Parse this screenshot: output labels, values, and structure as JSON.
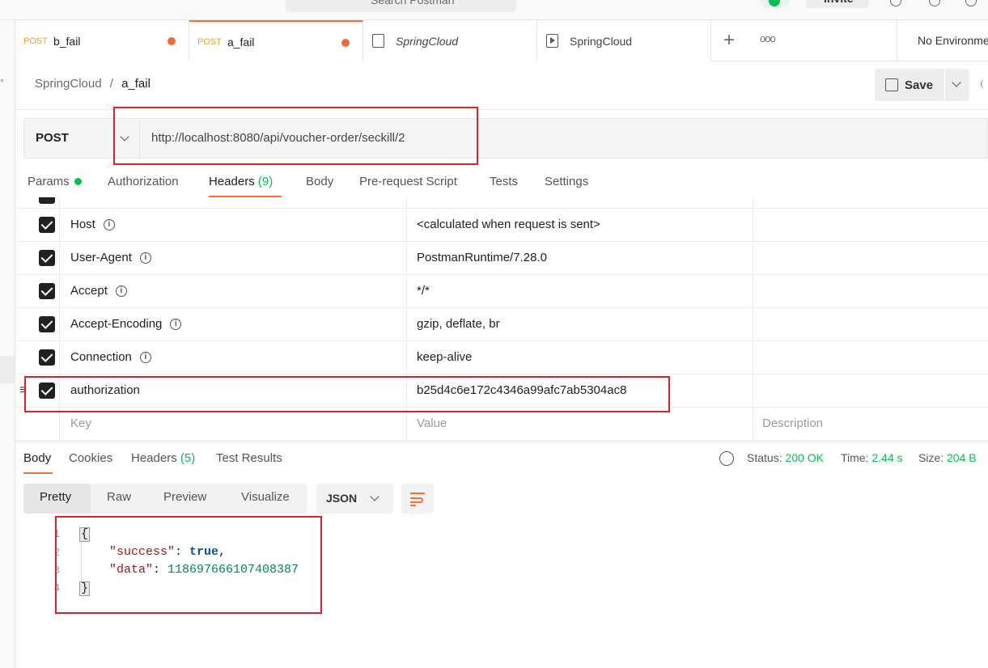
{
  "topbar": {
    "search_placeholder": "Search Postman",
    "invite_label": "Invite"
  },
  "tabs": [
    {
      "method": "POST",
      "name": "b_fail",
      "unsaved": true
    },
    {
      "method": "POST",
      "name": "a_fail",
      "unsaved": true,
      "active": true
    },
    {
      "name": "SpringCloud",
      "icon": "collection-icon"
    },
    {
      "name": "SpringCloud",
      "icon": "runner-icon"
    }
  ],
  "environment": {
    "label": "No Environment"
  },
  "breadcrumb": {
    "parent": "SpringCloud",
    "separator": "/",
    "current": "a_fail"
  },
  "toolbar": {
    "save_label": "Save"
  },
  "request": {
    "method": "POST",
    "url": "http://localhost:8080/api/voucher-order/seckill/2"
  },
  "request_tabs": {
    "params": "Params",
    "authorization": "Authorization",
    "headers": "Headers",
    "headers_count": "(9)",
    "body": "Body",
    "prerequest": "Pre-request Script",
    "tests": "Tests",
    "settings": "Settings"
  },
  "headers_table": {
    "rows": [
      {
        "key": "Host",
        "value": "<calculated when request is sent>"
      },
      {
        "key": "User-Agent",
        "value": "PostmanRuntime/7.28.0"
      },
      {
        "key": "Accept",
        "value": "*/*"
      },
      {
        "key": "Accept-Encoding",
        "value": "gzip, deflate, br"
      },
      {
        "key": "Connection",
        "value": "keep-alive"
      },
      {
        "key": "authorization",
        "value": "b25d4c6e172c4346a99afc7ab5304ac8"
      }
    ],
    "placeholder": {
      "key": "Key",
      "value": "Value",
      "description": "Description"
    }
  },
  "response": {
    "tabs": {
      "body": "Body",
      "cookies": "Cookies",
      "headers": "Headers",
      "headers_count": "(5)",
      "test_results": "Test Results"
    },
    "status_label": "Status:",
    "status_value": "200 OK",
    "time_label": "Time:",
    "time_value": "2.44 s",
    "size_label": "Size:",
    "size_value": "204 B",
    "formats": {
      "pretty": "Pretty",
      "raw": "Raw",
      "preview": "Preview",
      "visualize": "Visualize"
    },
    "language": "JSON",
    "code": {
      "open": "{",
      "k1": "\"success\"",
      "v1": "true",
      "k2": "\"data\"",
      "v2": "118697666107408387",
      "close": "}",
      "line_numbers": [
        "1",
        "2",
        "3",
        "4"
      ]
    }
  },
  "colors": {
    "accent": "#ff6c37",
    "status_green": "#0cbb52",
    "highlight_red": "#e0202a"
  }
}
